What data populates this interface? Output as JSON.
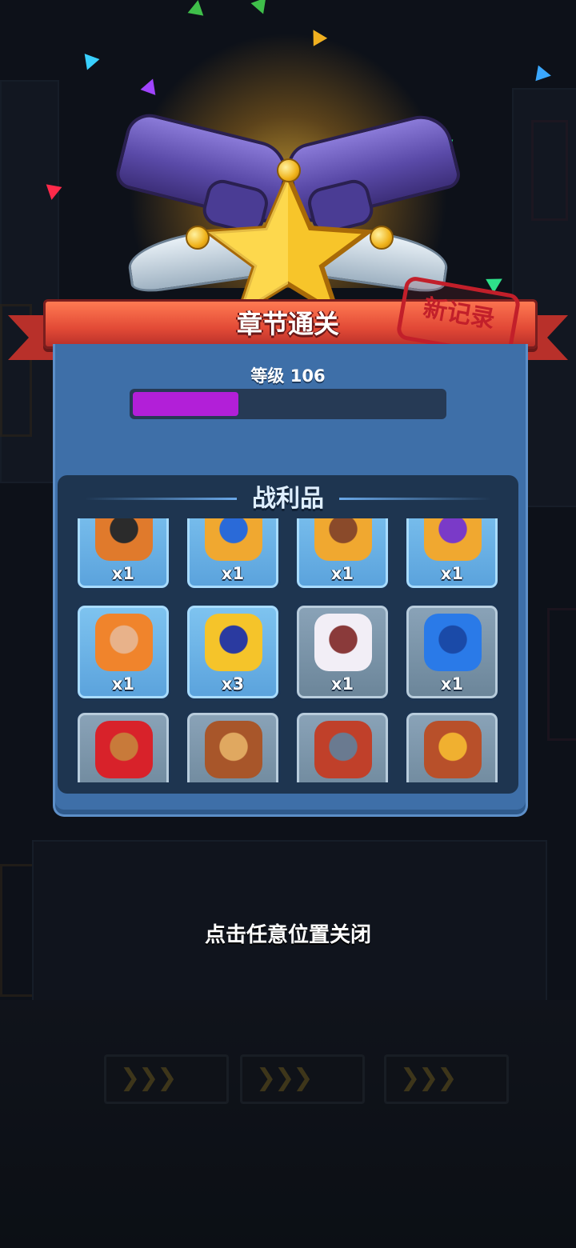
{
  "header": {
    "title": "章节通关",
    "stamp": "新记录"
  },
  "level": {
    "label": "等级 106",
    "progress": 0.34,
    "bar_color": "#b21fd8"
  },
  "loot": {
    "title": "战利品",
    "items": [
      {
        "icon": "hero-puzzle-gasmask-icon",
        "qty": "x1",
        "rarity": "blue"
      },
      {
        "icon": "hero-puzzle-blue-cat-icon",
        "qty": "x1",
        "rarity": "blue"
      },
      {
        "icon": "hero-puzzle-girl-gold-icon",
        "qty": "x1",
        "rarity": "blue"
      },
      {
        "icon": "hero-puzzle-ninja-girl-icon",
        "qty": "x1",
        "rarity": "blue"
      },
      {
        "icon": "hero-puzzle-redhead-icon",
        "qty": "x1",
        "rarity": "blue"
      },
      {
        "icon": "gold-puzzle-piece-icon",
        "qty": "x3",
        "rarity": "blue"
      },
      {
        "icon": "armor-vest-icon",
        "qty": "x1",
        "rarity": "gray"
      },
      {
        "icon": "blue-glove-icon",
        "qty": "x1",
        "rarity": "gray"
      },
      {
        "icon": "red-scarf-icon",
        "qty": "",
        "rarity": "gray"
      },
      {
        "icon": "brown-boot-icon",
        "qty": "",
        "rarity": "gray"
      },
      {
        "icon": "red-boot-icon",
        "qty": "",
        "rarity": "gray"
      },
      {
        "icon": "spur-boot-icon",
        "qty": "",
        "rarity": "gray"
      }
    ]
  },
  "footer": {
    "close_hint": "点击任意位置关闭"
  }
}
